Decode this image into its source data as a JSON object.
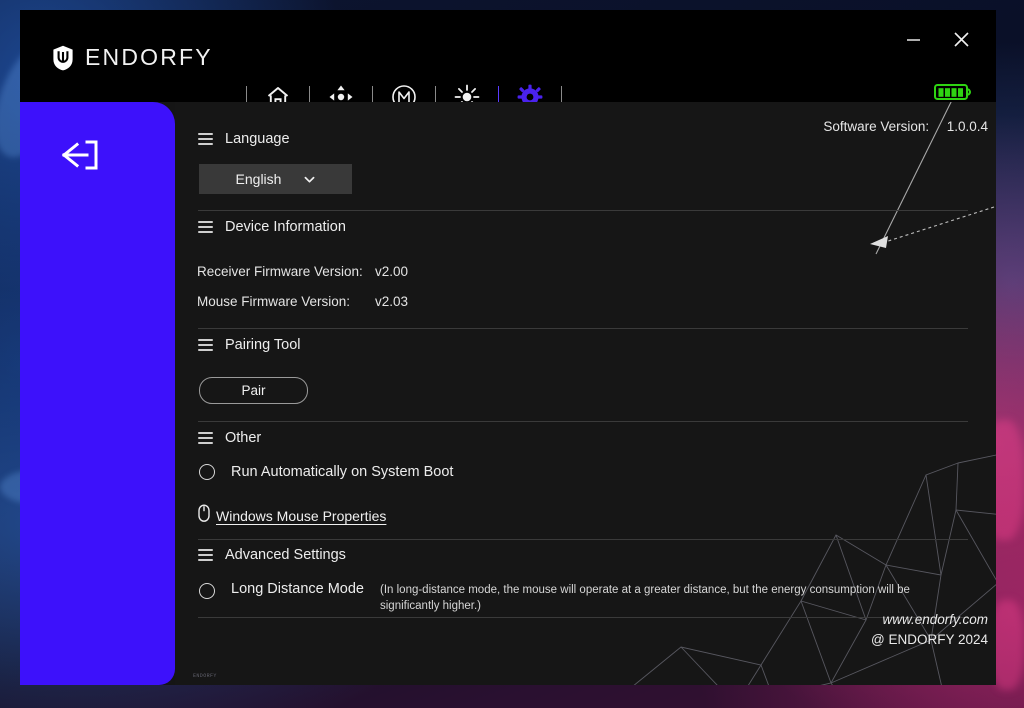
{
  "window": {
    "brand": "ENDORFY",
    "brand_icon": "endorfy-shield-logo",
    "minimize_icon": "minimize-icon",
    "close_icon": "close-icon",
    "battery_icon": "battery-full-icon",
    "battery_color": "#2fd412",
    "accent_color": "#3d11fb"
  },
  "nav": {
    "items": [
      {
        "icon": "home-icon",
        "name": "nav-home",
        "active": false
      },
      {
        "icon": "dpi-target-icon",
        "name": "nav-dpi",
        "active": false
      },
      {
        "icon": "macro-m-icon",
        "name": "nav-macro",
        "active": false
      },
      {
        "icon": "lighting-sun-icon",
        "name": "nav-lighting",
        "active": false
      },
      {
        "icon": "gear-icon",
        "name": "nav-settings",
        "active": true
      }
    ]
  },
  "sidebar": {
    "back_icon": "back-arrow-icon"
  },
  "content": {
    "software_version_label": "Software Version:",
    "software_version_value": "1.0.0.4",
    "sections": {
      "language": {
        "title": "Language",
        "selected": "English",
        "options": [
          "English"
        ],
        "chevron_icon": "chevron-down-icon"
      },
      "device_information": {
        "title": "Device Information",
        "rows": [
          {
            "label": "Receiver Firmware Version:",
            "value": "v2.00"
          },
          {
            "label": "Mouse Firmware Version:",
            "value": "v2.03"
          }
        ]
      },
      "pairing_tool": {
        "title": "Pairing Tool",
        "pair_button": "Pair"
      },
      "other": {
        "title": "Other",
        "run_on_boot_label": "Run Automatically on System Boot",
        "run_on_boot_checked": false,
        "mouse_properties_link": "Windows Mouse Properties",
        "mouse_properties_icon": "mouse-icon"
      },
      "advanced_settings": {
        "title": "Advanced Settings",
        "long_distance_label": "Long Distance Mode",
        "long_distance_checked": false,
        "long_distance_description": "(In long-distance mode, the mouse will operate at a greater distance, but the energy consumption will be significantly higher.)"
      }
    },
    "footer": {
      "website": "www.endorfy.com",
      "copyright": "@ ENDORFY 2024"
    },
    "tiny_status": "ENDORFY"
  }
}
